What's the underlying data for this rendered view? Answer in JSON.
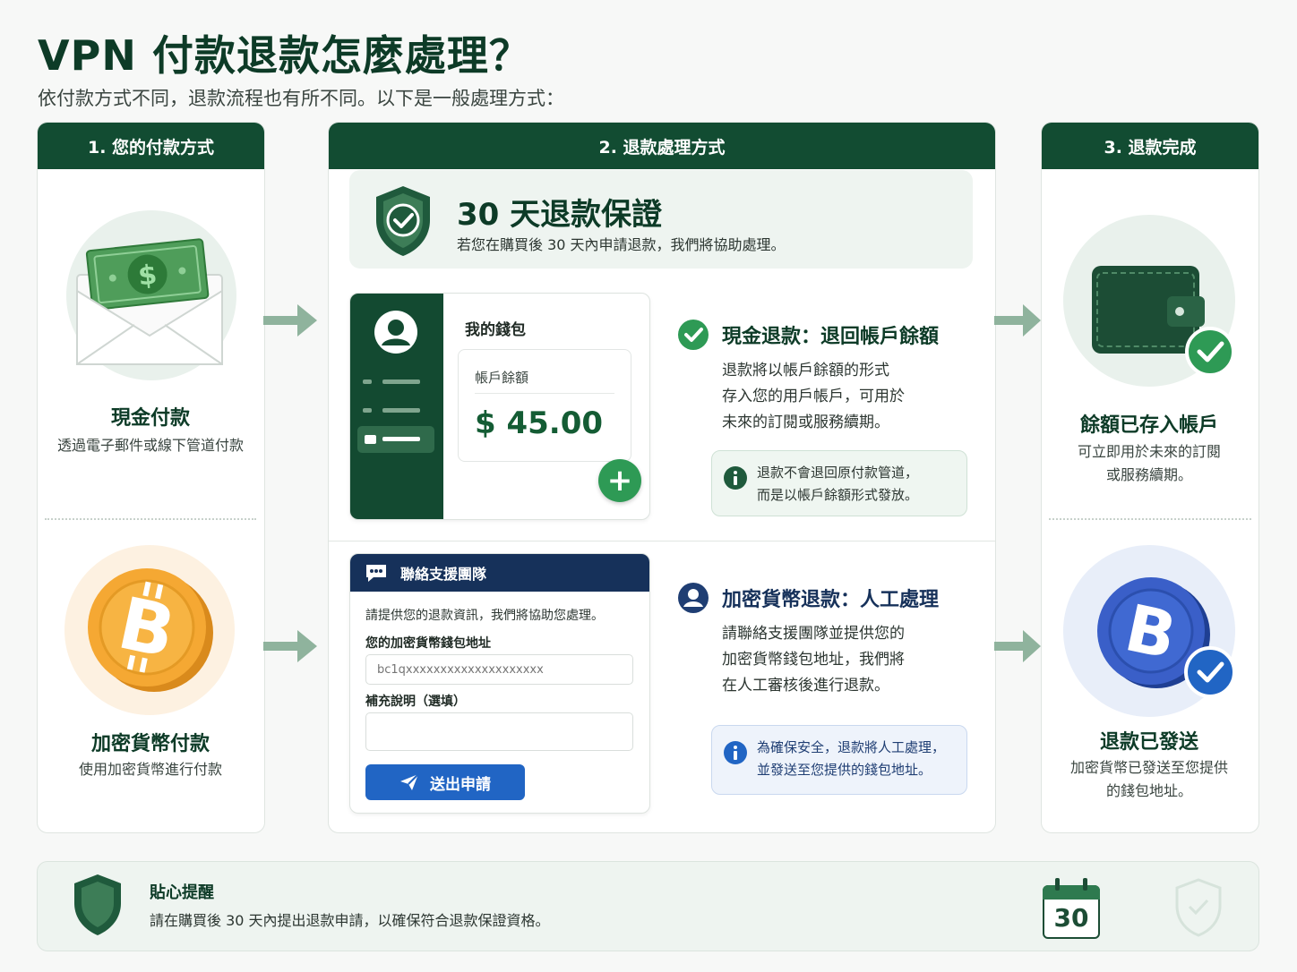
{
  "header": {
    "title": "VPN 付款退款怎麼處理？",
    "subtitle": "依付款方式不同，退款流程也有所不同。以下是一般處理方式："
  },
  "columns": {
    "col1_title": "1. 您的付款方式",
    "col2_title": "2. 退款處理方式",
    "col3_title": "3. 退款完成"
  },
  "payment": {
    "cash_title": "現金付款",
    "cash_desc": "透過電子郵件或線下管道付款",
    "crypto_title": "加密貨幣付款",
    "crypto_desc": "使用加密貨幣進行付款"
  },
  "guarantee": {
    "title": "30 天退款保證",
    "desc": "若您在購買後 30 天內申請退款，我們將協助處理。"
  },
  "wallet": {
    "title": "我的錢包",
    "balance_label": "帳戶餘額",
    "balance_value": "$ 45.00"
  },
  "cash_refund": {
    "title": "現金退款：退回帳戶餘額",
    "line1": "退款將以帳戶餘額的形式",
    "line2": "存入您的用戶帳戶，可用於",
    "line3": "未來的訂閱或服務續期。",
    "note1": "退款不會退回原付款管道，",
    "note2": "而是以帳戶餘額形式發放。"
  },
  "form": {
    "header": "聯絡支援團隊",
    "intro": "請提供您的退款資訊，我們將協助您處理。",
    "wallet_label": "您的加密貨幣錢包地址",
    "wallet_placeholder": "bc1qxxxxxxxxxxxxxxxxxxxx",
    "note_label": "補充說明（選填）",
    "submit": "送出申請"
  },
  "crypto_refund": {
    "title": "加密貨幣退款：人工處理",
    "line1": "請聯絡支援團隊並提供您的",
    "line2": "加密貨幣錢包地址，我們將",
    "line3": "在人工審核後進行退款。",
    "note1": "為確保安全，退款將人工處理，",
    "note2": "並發送至您提供的錢包地址。"
  },
  "done": {
    "balance_title": "餘額已存入帳戶",
    "balance_line1": "可立即用於未來的訂閱",
    "balance_line2": "或服務續期。",
    "sent_title": "退款已發送",
    "sent_line1": "加密貨幣已發送至您提供",
    "sent_line2": "的錢包地址。"
  },
  "reminder": {
    "title": "貼心提醒",
    "desc": "請在購買後 30 天內提出退款申請，以確保符合退款保證資格。",
    "calendar_day": "30"
  },
  "colors": {
    "primary_green": "#124c32",
    "accent_green": "#2e9a55",
    "navy": "#16315a",
    "blue": "#2165c4",
    "bitcoin_orange": "#f0a330"
  },
  "icons": {
    "cash": "money-envelope-icon",
    "crypto": "bitcoin-coin-icon",
    "shield": "shield-check-icon",
    "wallet": "wallet-icon",
    "user": "user-icon",
    "info": "info-icon",
    "chat": "chat-icon",
    "send": "send-icon",
    "calendar": "calendar-icon"
  }
}
